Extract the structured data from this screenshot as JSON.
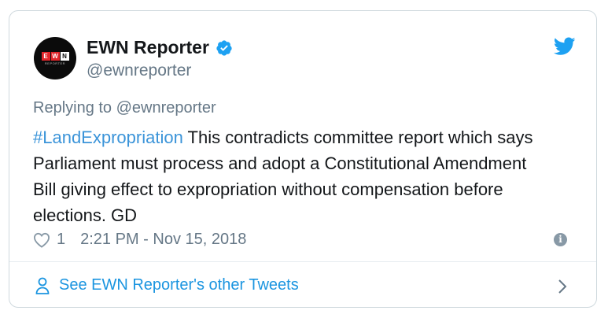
{
  "author": {
    "name": "EWN Reporter",
    "handle": "@ewnreporter",
    "avatar_text": "EWN",
    "avatar_subtext": "REPORTER"
  },
  "reply": {
    "prefix": "Replying to ",
    "mention": "@ewnreporter"
  },
  "tweet": {
    "hashtag": "#LandExpropriation",
    "body": " This contradicts committee report which says Parliament must process and adopt a Constitutional Amendment Bill giving effect to expropriation without compensation before elections. GD"
  },
  "meta": {
    "likes": "1",
    "timestamp": "2:21 PM - Nov 15, 2018"
  },
  "footer": {
    "link_text": "See EWN Reporter's other Tweets"
  },
  "icons": {
    "verified": "verified-badge-icon",
    "bird": "twitter-bird-icon",
    "heart": "heart-icon",
    "info": "info-icon",
    "person": "person-icon",
    "chevron": "chevron-right-icon"
  },
  "colors": {
    "link": "#1b95e0",
    "secondary_text": "#657786",
    "border": "#cfd9de"
  }
}
